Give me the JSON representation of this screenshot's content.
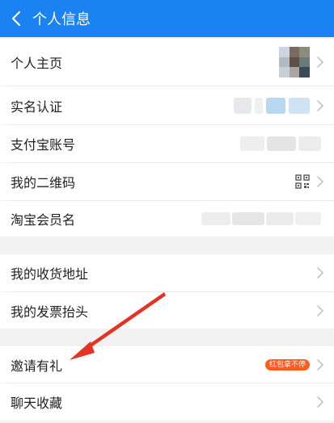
{
  "header": {
    "title": "个人信息"
  },
  "rows": {
    "profile": "个人主页",
    "real_name": "实名认证",
    "alipay": "支付宝账号",
    "qrcode": "我的二维码",
    "taobao_name": "淘宝会员名",
    "address": "我的收货地址",
    "invoice": "我的发票抬头",
    "invite": "邀请有礼",
    "chat": "聊天收藏"
  },
  "badge": {
    "invite": "红包拿不停"
  },
  "colors": {
    "header_bg": "#1b82f3",
    "badge_bg": "#ff5a1f",
    "arrow": "#e53222"
  },
  "icons": {
    "back": "chevron-left-icon",
    "row_arrow": "chevron-right-icon",
    "qrcode": "qr-code-icon"
  }
}
